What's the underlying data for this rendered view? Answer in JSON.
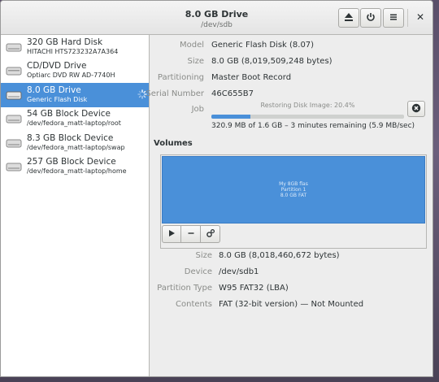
{
  "header": {
    "title": "8.0 GB Drive",
    "subtitle": "/dev/sdb",
    "buttons": {
      "eject": "eject-icon",
      "power": "power-icon",
      "menu": "menu-icon",
      "close": "✕"
    }
  },
  "sidebar": {
    "drives": [
      {
        "name": "320 GB Hard Disk",
        "sub": "HITACHI HTS723232A7A364",
        "icon": "harddisk-icon"
      },
      {
        "name": "CD/DVD Drive",
        "sub": "Optiarc DVD RW AD-7740H",
        "icon": "optical-drive-icon"
      },
      {
        "name": "8.0 GB Drive",
        "sub": "Generic Flash Disk",
        "icon": "usb-drive-icon",
        "selected": true
      },
      {
        "name": "54 GB Block Device",
        "sub": "/dev/fedora_matt-laptop/root",
        "icon": "block-device-icon"
      },
      {
        "name": "8.3 GB Block Device",
        "sub": "/dev/fedora_matt-laptop/swap",
        "icon": "block-device-icon"
      },
      {
        "name": "257 GB Block Device",
        "sub": "/dev/fedora_matt-laptop/home",
        "icon": "block-device-icon"
      }
    ]
  },
  "drive_info": {
    "model_label": "Model",
    "model": "Generic Flash Disk (8.07)",
    "size_label": "Size",
    "size": "8.0 GB (8,019,509,248 bytes)",
    "partitioning_label": "Partitioning",
    "partitioning": "Master Boot Record",
    "serial_label": "Serial Number",
    "serial": "46C655B7",
    "job_label": "Job",
    "job_status": "Restoring Disk Image: 20.4%",
    "job_progress": 0.204,
    "job_detail": "320.9 MB of 1.6 GB – 3 minutes remaining (5.9 MB/sec)"
  },
  "volumes": {
    "title": "Volumes",
    "partition_lines": [
      "My 8GB flas",
      "Partition 1",
      "8.0 GB FAT"
    ],
    "size_label": "Size",
    "size": "8.0 GB (8,018,460,672 bytes)",
    "device_label": "Device",
    "device": "/dev/sdb1",
    "ptype_label": "Partition Type",
    "ptype": "W95 FAT32 (LBA)",
    "contents_label": "Contents",
    "contents": "FAT (32-bit version) — Not Mounted"
  },
  "colors": {
    "accent": "#4a90d9",
    "label": "#8a8c89",
    "text": "#2e3436"
  }
}
